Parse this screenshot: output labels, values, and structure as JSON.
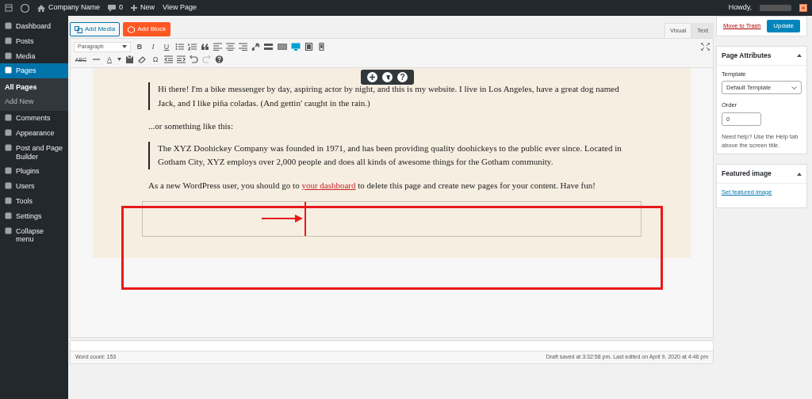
{
  "admin_bar": {
    "site_name": "Company Name",
    "comments_count": "0",
    "new_label": "New",
    "view_label": "View Page",
    "greeting": "Howdy,"
  },
  "sidebar": {
    "items": [
      {
        "label": "Dashboard",
        "selected": false
      },
      {
        "label": "Posts",
        "selected": false
      },
      {
        "label": "Media",
        "selected": false
      },
      {
        "label": "Pages",
        "selected": true,
        "children": [
          {
            "label": "All Pages",
            "selected": true
          },
          {
            "label": "Add New",
            "selected": false
          }
        ]
      },
      {
        "label": "Comments",
        "selected": false
      },
      {
        "label": "Appearance",
        "selected": false
      },
      {
        "label": "Post and Page Builder",
        "selected": false
      },
      {
        "label": "Plugins",
        "selected": false
      },
      {
        "label": "Users",
        "selected": false
      },
      {
        "label": "Tools",
        "selected": false
      },
      {
        "label": "Settings",
        "selected": false
      },
      {
        "label": "Collapse menu",
        "selected": false
      }
    ]
  },
  "editor": {
    "buttons": [
      {
        "label": "Add Media",
        "kind": "media"
      },
      {
        "label": "Add Block",
        "kind": "block"
      }
    ],
    "tabs": [
      {
        "label": "Visual",
        "selected": true
      },
      {
        "label": "Text",
        "selected": false
      }
    ],
    "format_select": "Paragraph",
    "glyphs": {
      "bold": "B",
      "italic": "I",
      "underline": "U",
      "special_char": "Ω",
      "text_color": "A",
      "strike": "ABC"
    },
    "floating_help": "?",
    "content": [
      {
        "kind": "quote",
        "text": "Hi there! I'm a bike messenger by day, aspiring actor by night, and this is my website. I live in Los Angeles, have a great dog named Jack, and I like piña coladas. (And gettin' caught in the rain.)"
      },
      {
        "kind": "para",
        "text": "...or something like this:"
      },
      {
        "kind": "quote",
        "text": "The XYZ Doohickey Company was founded in 1971, and has been providing quality doohickeys to the public ever since. Located in Gotham City, XYZ employs over 2,000 people and does all kinds of awesome things for the Gotham community."
      },
      {
        "kind": "link_para",
        "before": "As a new WordPress user, you should go to ",
        "link": "your dashboard",
        "after": " to delete this page and create new pages for your content. Have fun!"
      },
      {
        "kind": "empty_block"
      }
    ],
    "word_count": "Word count: 153",
    "save_status": "Draft saved at 3:32:58 pm. Last edited on April 9, 2020 at 4:46 pm"
  },
  "publish": {
    "trash": "Move to Trash",
    "update": "Update"
  },
  "page_attributes": {
    "title": "Page Attributes",
    "template_label": "Template",
    "template_value": "Default Template",
    "order_label": "Order",
    "order_value": "0",
    "help": "Need help? Use the Help tab above the screen title."
  },
  "featured_image": {
    "title": "Featured image",
    "link": "Set featured image"
  }
}
